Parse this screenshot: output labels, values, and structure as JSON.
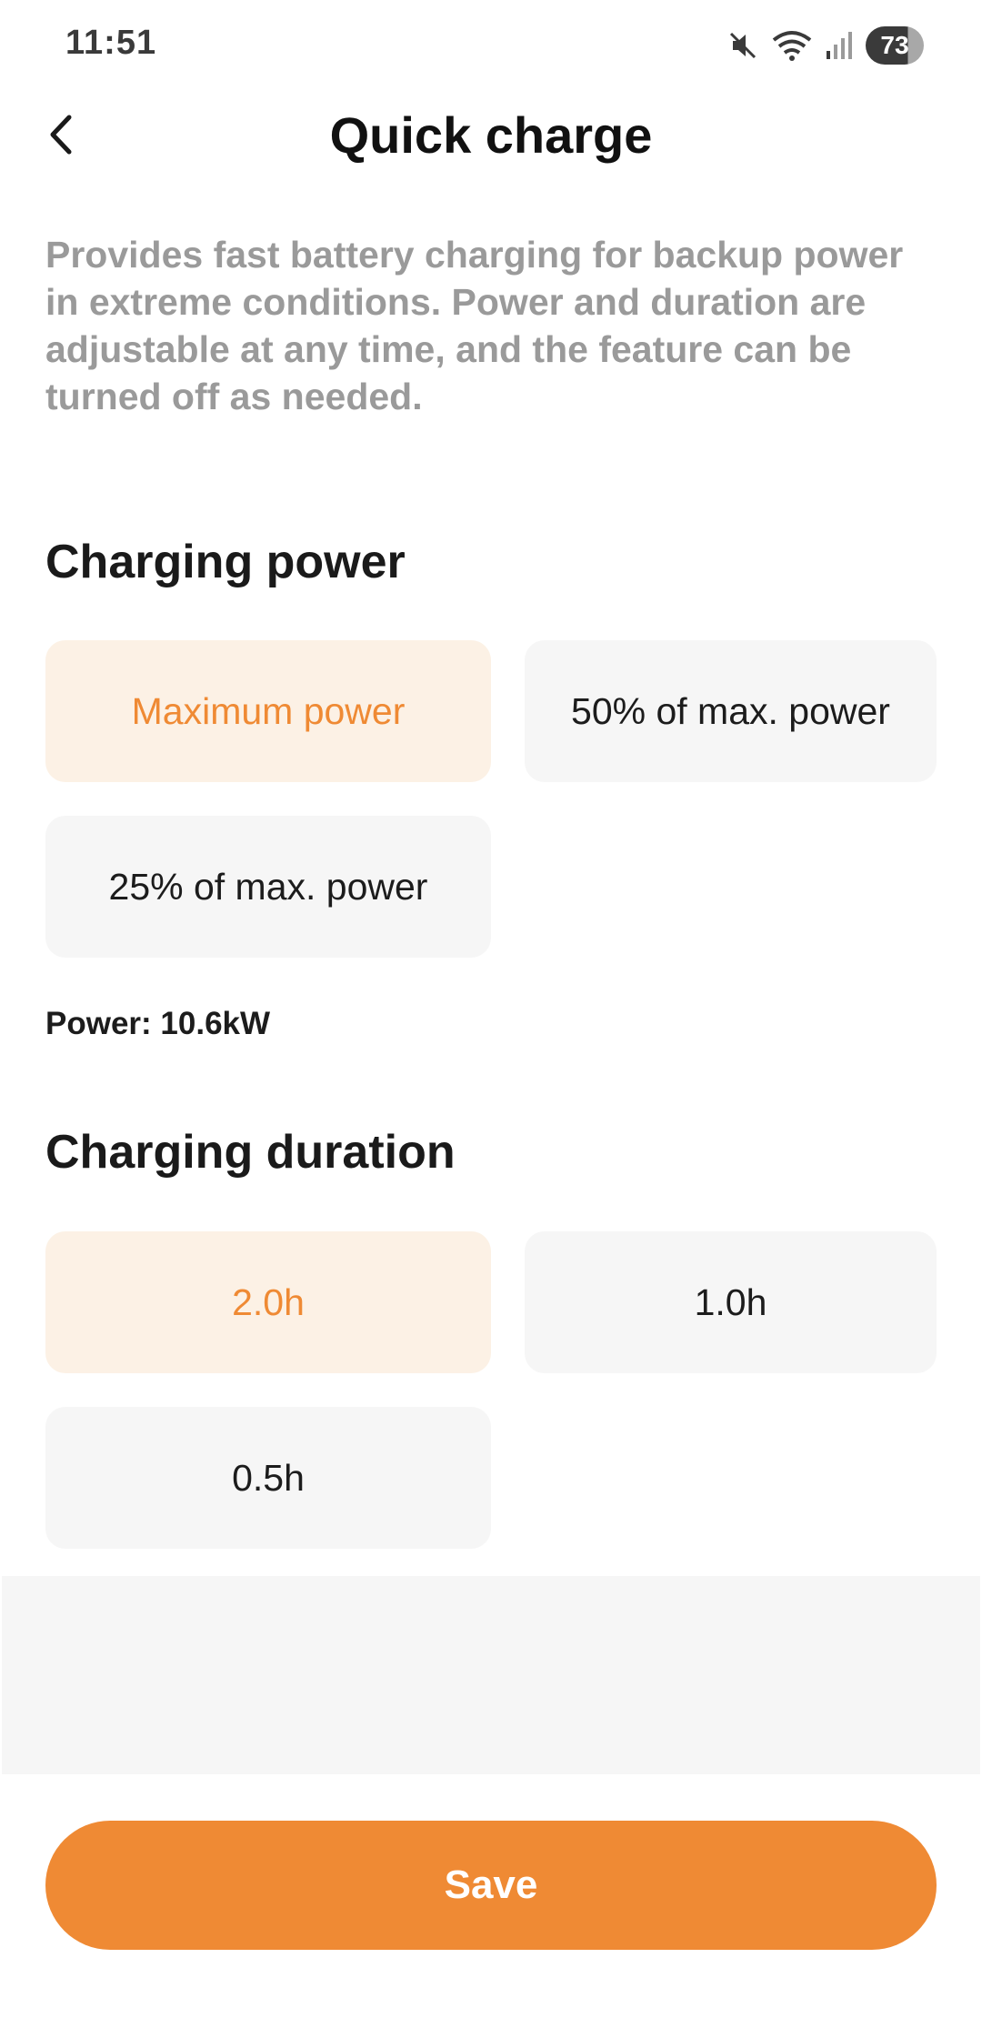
{
  "status_bar": {
    "time": "11:51",
    "battery_level": "73",
    "icons": [
      "mute-icon",
      "wifi-icon",
      "signal-icon",
      "battery-icon"
    ]
  },
  "header": {
    "title": "Quick charge",
    "back_icon": "chevron-left-icon"
  },
  "description": "Provides fast battery charging for backup power in extreme conditions. Power and duration are adjustable at any time, and the feature can be turned off as needed.",
  "charging_power": {
    "title": "Charging power",
    "options": [
      {
        "label": "Maximum power",
        "selected": true
      },
      {
        "label": "50% of max. power",
        "selected": false
      },
      {
        "label": "25% of max. power",
        "selected": false
      }
    ],
    "readout": "Power: 10.6kW"
  },
  "charging_duration": {
    "title": "Charging duration",
    "options": [
      {
        "label": "2.0h",
        "selected": true
      },
      {
        "label": "1.0h",
        "selected": false
      },
      {
        "label": "0.5h",
        "selected": false
      }
    ]
  },
  "save_label": "Save",
  "colors": {
    "accent": "#ef8a34",
    "selected_bg": "#fcf1e5",
    "option_bg": "#f6f6f6",
    "description_text": "#9a9a9a"
  }
}
